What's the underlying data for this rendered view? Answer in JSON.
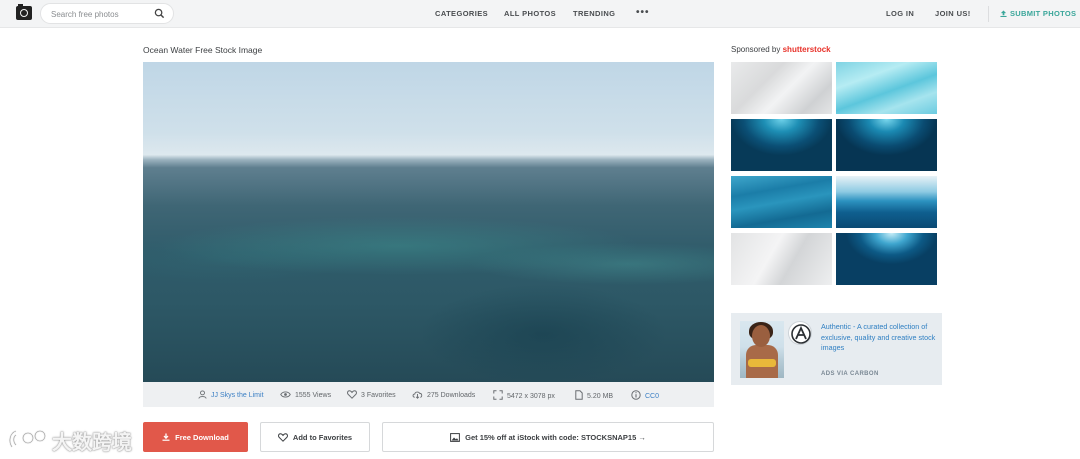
{
  "header": {
    "search_placeholder": "Search free photos",
    "nav": [
      "CATEGORIES",
      "ALL PHOTOS",
      "TRENDING"
    ],
    "more": "•••",
    "login": "LOG IN",
    "join": "JOIN US!",
    "submit": "SUBMIT PHOTOS"
  },
  "photo": {
    "title": "Ocean Water Free Stock Image",
    "author": "JJ Skys the Limit",
    "views": "1555 Views",
    "favorites": "3 Favorites",
    "downloads": "275 Downloads",
    "dimensions": "5472 x 3078 px",
    "size": "5.20 MB",
    "license": "CC0"
  },
  "actions": {
    "download": "Free Download",
    "favorite": "Add to Favorites",
    "istock": "Get 15% off at iStock with code: STOCKSNAP15 →"
  },
  "sidebar": {
    "sponsored_prefix": "Sponsored by",
    "sponsored_brand": "shutterstock",
    "thumbnails": [
      "white water texture",
      "light blue pool water",
      "underwater light rays",
      "deep underwater light",
      "blue water surface",
      "ocean surface underwater split",
      "white wave foam",
      "sunlight underwater"
    ]
  },
  "ad": {
    "text": "Authentic - A curated collection of exclusive, quality and creative stock images",
    "via": "ADS VIA CARBON"
  },
  "watermark": {
    "text": "大数跨境"
  },
  "colors": {
    "download_button": "#e1584a",
    "submit_accent": "#3aa69a",
    "link": "#3b7fc4",
    "brand": "#e8322a"
  }
}
